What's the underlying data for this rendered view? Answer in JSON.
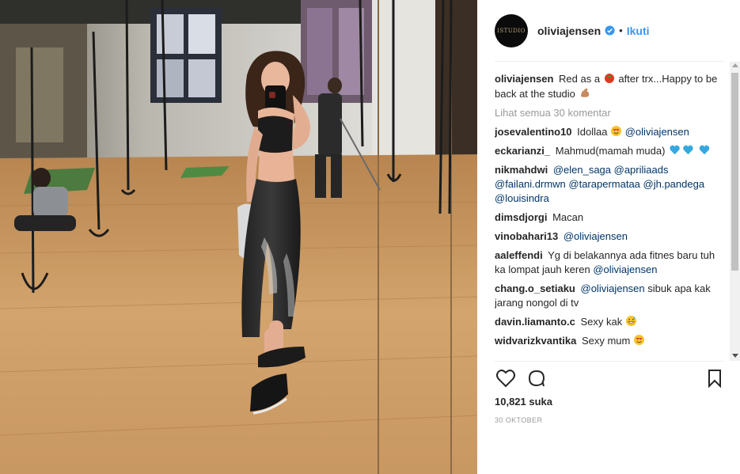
{
  "header": {
    "username": "oliviajensen",
    "separator": "•",
    "follow_label": "Ikuti",
    "avatar_icon": "studio-logo-avatar"
  },
  "caption": {
    "username": "oliviajensen",
    "text_before": "Red as a",
    "emoji_1": "tomato-icon",
    "text_after": "after trx...Happy to be back at the studio",
    "emoji_2": "flexed-biceps-icon"
  },
  "view_all": "Lihat semua 30 komentar",
  "comments": [
    {
      "user": "josevalentino10",
      "text": "Idollaa",
      "emoji": "heart-eyes-icon",
      "mention": "@oliviajensen"
    },
    {
      "user": "eckarianzi_",
      "text": "Mahmud(mamah muda)",
      "emoji": "blue-hearts-icon"
    },
    {
      "user": "nikmahdwi",
      "mentions": "@elen_saga @apriliaads @failani.drmwn @tarapermataa @jh.pandega @louisindra"
    },
    {
      "user": "dimsdjorgi",
      "text": "Macan"
    },
    {
      "user": "vinobahari13",
      "mention": "@oliviajensen"
    },
    {
      "user": "aaleffendi",
      "text": "Yg di belakannya ada fitnes baru tuh ka lompat jauh keren",
      "mention": "@oliviajensen"
    },
    {
      "user": "chang.o_setiaku",
      "mention": "@oliviajensen",
      "text": "sibuk apa kak jarang nongol di tv"
    },
    {
      "user": "davin.liamanto.c",
      "text": "Sexy kak",
      "emoji": "grinning-sweat-icon"
    },
    {
      "user": "widvarizkvantika",
      "text": "Sexy mum",
      "emoji": "heart-eyes-icon"
    }
  ],
  "likes": "10,821 suka",
  "date": "30 OKTOBER",
  "colors": {
    "link": "#3897f0",
    "mention": "#003569",
    "muted": "#999999",
    "text": "#262626",
    "floor": "#c8955f"
  }
}
